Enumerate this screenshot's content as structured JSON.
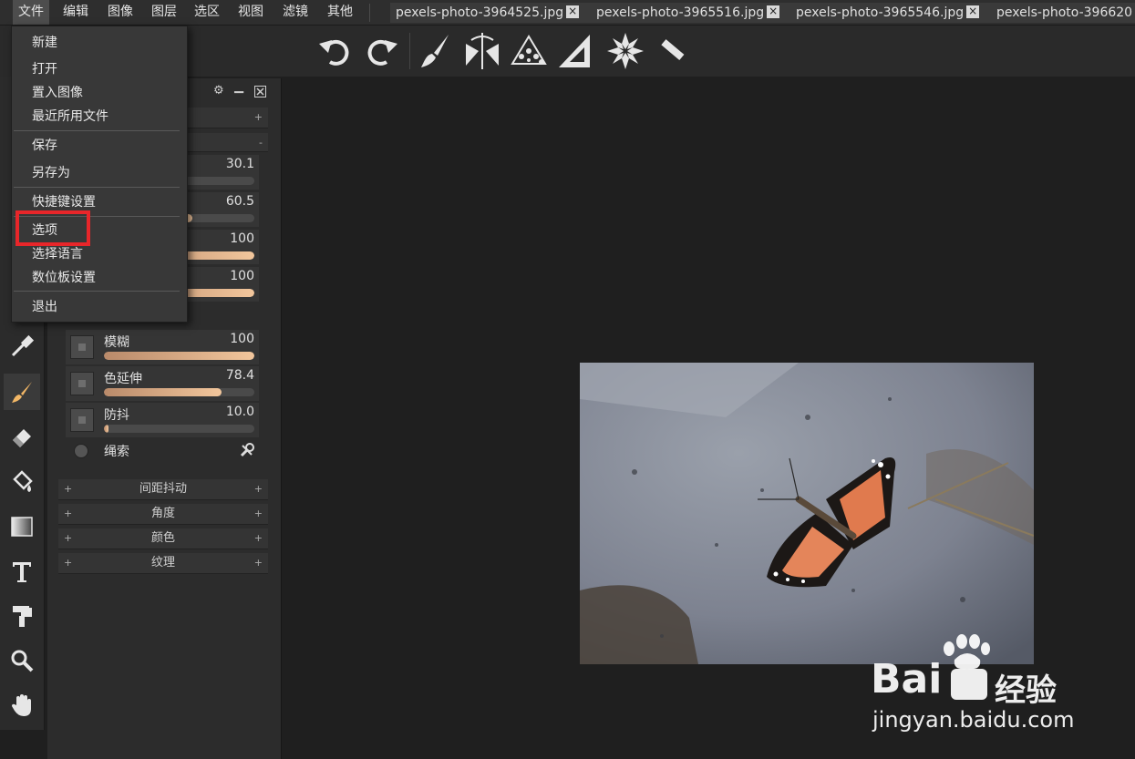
{
  "menubar": {
    "items": [
      "文件",
      "编辑",
      "图像",
      "图层",
      "选区",
      "视图",
      "滤镜",
      "其他"
    ],
    "active_index": 0
  },
  "tabs": [
    {
      "label": "pexels-photo-3964525.jpg",
      "close": "×"
    },
    {
      "label": "pexels-photo-3965516.jpg",
      "close": "×"
    },
    {
      "label": "pexels-photo-3965546.jpg",
      "close": "×"
    },
    {
      "label": "pexels-photo-396620",
      "close": ""
    }
  ],
  "options_toolbar": {
    "icons": [
      "undo-icon",
      "redo-icon",
      "brush-tool-icon",
      "mirror-icon",
      "spray-particles-icon",
      "set-square-icon",
      "kaleidoscope-icon",
      "ruler-icon"
    ]
  },
  "left_toolbar": {
    "icons": [
      "eyedropper-icon",
      "brush-icon",
      "eraser-icon",
      "paint-bucket-icon",
      "gradient-icon",
      "text-icon",
      "clone-stamp-icon",
      "zoom-icon",
      "hand-icon"
    ],
    "selected": "brush-icon"
  },
  "file_menu": {
    "items": [
      "新建",
      "打开",
      "置入图像",
      "最近所用文件",
      "保存",
      "另存为",
      "快捷键设置",
      "选项",
      "选择语言",
      "数位板设置",
      "退出"
    ],
    "highlighted": "选项"
  },
  "brush_panel": {
    "header_icons": [
      "gear-icon",
      "minimize-icon",
      "close-icon"
    ],
    "params_top": [
      {
        "value": "30.1",
        "fill": 0.0
      },
      {
        "value": "60.5",
        "fill": 0.57
      },
      {
        "value": "100",
        "fill": 1.0
      },
      {
        "value": "100",
        "fill": 1.0
      }
    ],
    "params": [
      {
        "label": "模糊",
        "value": "100",
        "fill": 1.0
      },
      {
        "label": "色延伸",
        "value": "78.4",
        "fill": 0.78
      },
      {
        "label": "防抖",
        "value": "10.0",
        "fill": 0.03
      }
    ],
    "lasso_label": "绳索",
    "sections": [
      "间距抖动",
      "角度",
      "颜色",
      "纹理"
    ],
    "section_plus": "+",
    "section_minus": "-"
  },
  "watermark": {
    "brand": "Bai",
    "brand_suffix": "经验",
    "url": "jingyan.baidu.com"
  },
  "colors": {
    "highlight": "#e8262a",
    "slider_fill": "#f2c69c"
  }
}
